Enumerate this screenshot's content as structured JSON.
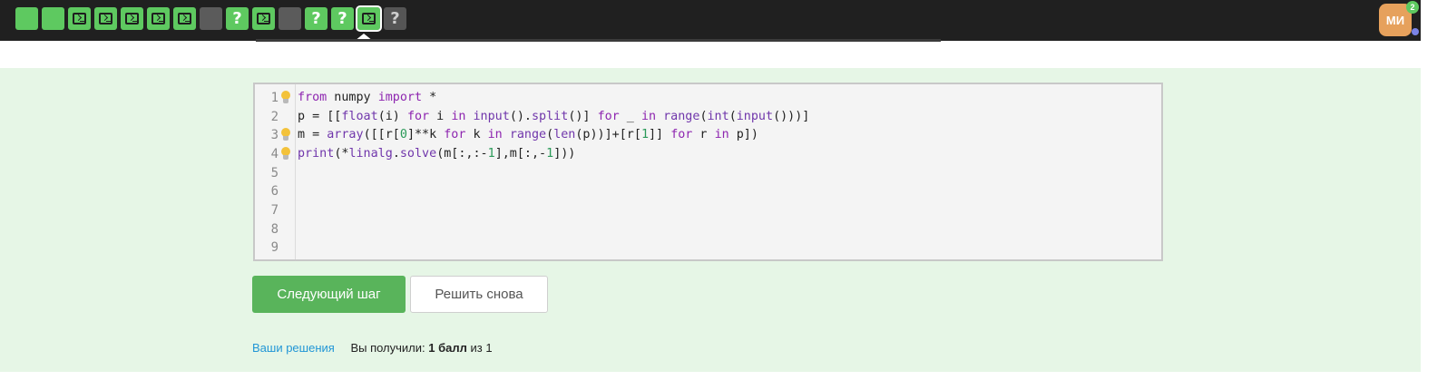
{
  "steps": [
    {
      "state": "green",
      "icon": "none"
    },
    {
      "state": "green",
      "icon": "none"
    },
    {
      "state": "green",
      "icon": "terminal"
    },
    {
      "state": "green",
      "icon": "terminal"
    },
    {
      "state": "green",
      "icon": "terminal"
    },
    {
      "state": "green",
      "icon": "terminal"
    },
    {
      "state": "green",
      "icon": "terminal"
    },
    {
      "state": "gray",
      "icon": "none"
    },
    {
      "state": "green",
      "icon": "question"
    },
    {
      "state": "green",
      "icon": "terminal"
    },
    {
      "state": "gray",
      "icon": "none"
    },
    {
      "state": "green",
      "icon": "question"
    },
    {
      "state": "green",
      "icon": "question"
    },
    {
      "state": "green-active",
      "icon": "terminal"
    },
    {
      "state": "gray",
      "icon": "question"
    }
  ],
  "user": {
    "initials": "МИ",
    "notifications": "2"
  },
  "editor": {
    "line_numbers": [
      "1",
      "2",
      "3",
      "4",
      "5",
      "6",
      "7",
      "8",
      "9"
    ],
    "hint_lines": [
      1,
      3,
      4
    ],
    "lines": [
      "from numpy import *",
      "p = [[float(i) for i in input().split()] for _ in range(int(input()))]",
      "m = array([[r[0]**k for k in range(len(p))]+[r[1]] for r in p])",
      "print(*linalg.solve(m[:,:-1],m[:,-1]))",
      "",
      "",
      "",
      "",
      ""
    ]
  },
  "buttons": {
    "next_step": "Следующий шаг",
    "solve_again": "Решить снова"
  },
  "footer": {
    "solutions_link": "Ваши решения",
    "score_prefix": "Вы получили:",
    "score_value": "1 балл",
    "score_suffix": "из 1"
  },
  "colors": {
    "topbar": "#202020",
    "step_green": "#5ec960",
    "step_gray": "#5b5b5b",
    "content_bg": "#e6f6e6",
    "primary_button": "#59b45b",
    "link": "#2196d6",
    "avatar": "#e6a15c"
  }
}
